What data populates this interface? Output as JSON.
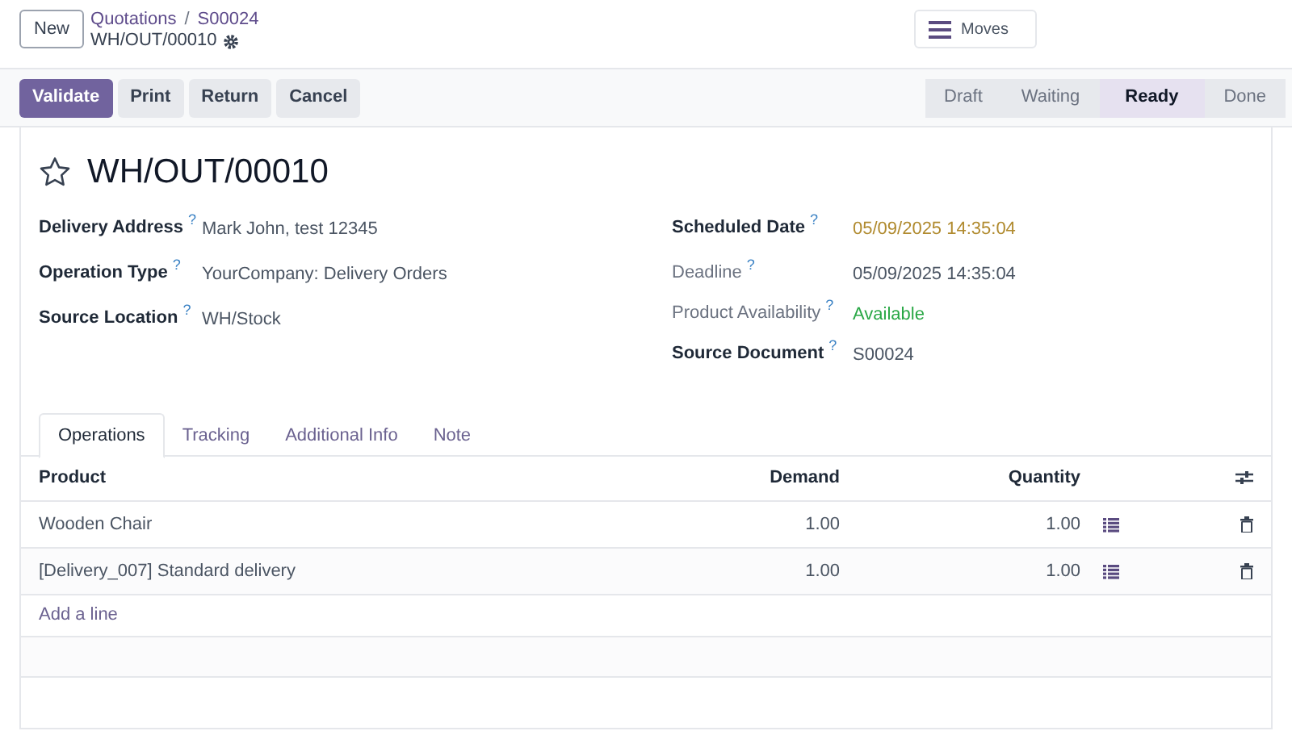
{
  "control_panel": {
    "new_button": "New",
    "breadcrumb_separator": "/",
    "breadcrumb": [
      {
        "label": "Quotations"
      },
      {
        "label": "S00024"
      }
    ],
    "record_name": "WH/OUT/00010",
    "moves_button": "Moves"
  },
  "actions": [
    "Validate",
    "Print",
    "Return",
    "Cancel"
  ],
  "status_steps": [
    {
      "label": "Draft",
      "selected": false
    },
    {
      "label": "Waiting",
      "selected": false
    },
    {
      "label": "Ready",
      "selected": true
    },
    {
      "label": "Done",
      "selected": false
    }
  ],
  "title": {
    "text": "WH/OUT/00010",
    "starred": false
  },
  "left_fields": [
    {
      "label": "Delivery Address",
      "help": "?",
      "muted": false,
      "value": "Mark John, test 12345",
      "kind": "normal"
    },
    {
      "label": "Operation Type",
      "help": "?",
      "muted": false,
      "value": "YourCompany: Delivery Orders",
      "kind": "normal"
    },
    {
      "label": "Source Location",
      "help": "?",
      "muted": false,
      "value": "WH/Stock",
      "kind": "normal"
    }
  ],
  "right_fields": [
    {
      "label": "Scheduled Date",
      "help": "?",
      "muted": false,
      "value": "05/09/2025 14:35:04",
      "kind": "warning"
    },
    {
      "label": "Deadline",
      "help": "?",
      "muted": true,
      "value": "05/09/2025 14:35:04",
      "kind": "normal"
    },
    {
      "label": "Product Availability",
      "help": "?",
      "muted": true,
      "value": "Available",
      "kind": "success"
    },
    {
      "label": "Source Document",
      "help": "?",
      "muted": false,
      "value": "S00024",
      "kind": "normal"
    }
  ],
  "tabs": [
    {
      "label": "Operations",
      "selected": true
    },
    {
      "label": "Tracking",
      "selected": false
    },
    {
      "label": "Additional Info",
      "selected": false
    },
    {
      "label": "Note",
      "selected": false
    }
  ],
  "table": {
    "columns": [
      "Product",
      "Demand",
      "Quantity"
    ],
    "rows": [
      {
        "product": "Wooden Chair",
        "demand": "1.00",
        "quantity": "1.00"
      },
      {
        "product": "[Delivery_007] Standard delivery",
        "demand": "1.00",
        "quantity": "1.00"
      }
    ],
    "add_line": "Add a line"
  }
}
